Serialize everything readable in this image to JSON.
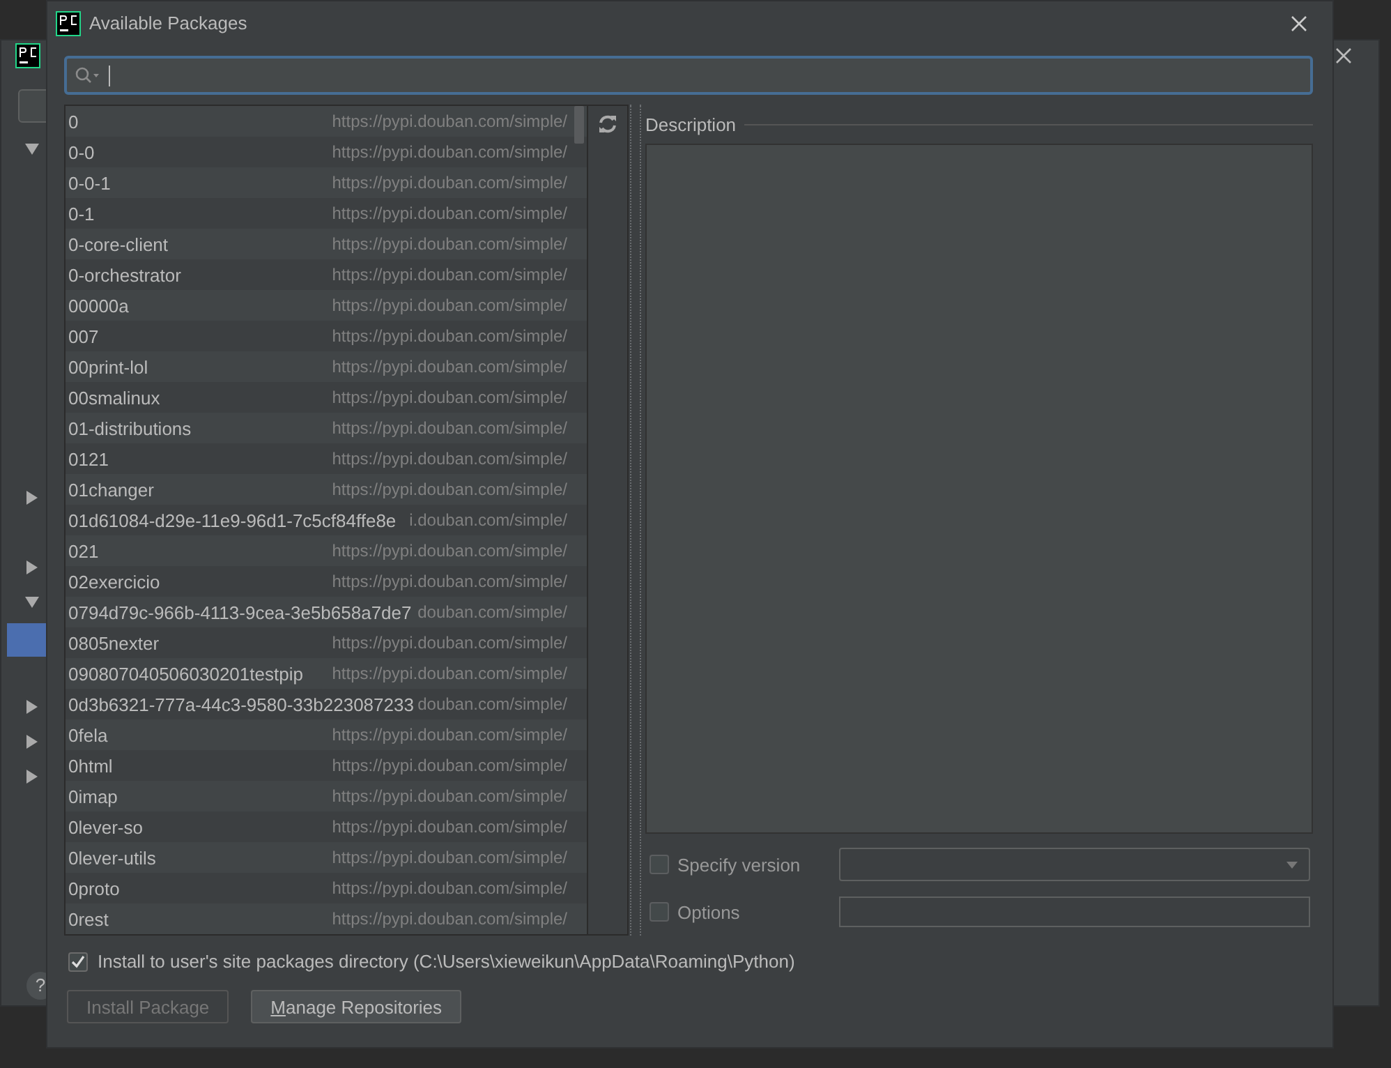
{
  "background_window": {
    "help": "?"
  },
  "window": {
    "title": "Available Packages"
  },
  "packages": [
    {
      "name": "0",
      "repository": "https://pypi.douban.com/simple/"
    },
    {
      "name": "0-0",
      "repository": "https://pypi.douban.com/simple/"
    },
    {
      "name": "0-0-1",
      "repository": "https://pypi.douban.com/simple/"
    },
    {
      "name": "0-1",
      "repository": "https://pypi.douban.com/simple/"
    },
    {
      "name": "0-core-client",
      "repository": "https://pypi.douban.com/simple/"
    },
    {
      "name": "0-orchestrator",
      "repository": "https://pypi.douban.com/simple/"
    },
    {
      "name": "00000a",
      "repository": "https://pypi.douban.com/simple/"
    },
    {
      "name": "007",
      "repository": "https://pypi.douban.com/simple/"
    },
    {
      "name": "00print-lol",
      "repository": "https://pypi.douban.com/simple/"
    },
    {
      "name": "00smalinux",
      "repository": "https://pypi.douban.com/simple/"
    },
    {
      "name": "01-distributions",
      "repository": "https://pypi.douban.com/simple/"
    },
    {
      "name": "0121",
      "repository": "https://pypi.douban.com/simple/"
    },
    {
      "name": "01changer",
      "repository": "https://pypi.douban.com/simple/"
    },
    {
      "name": "01d61084-d29e-11e9-96d1-7c5cf84ffe8e",
      "repository": "i.douban.com/simple/"
    },
    {
      "name": "021",
      "repository": "https://pypi.douban.com/simple/"
    },
    {
      "name": "02exercicio",
      "repository": "https://pypi.douban.com/simple/"
    },
    {
      "name": "0794d79c-966b-4113-9cea-3e5b658a7de7",
      "repository": "douban.com/simple/"
    },
    {
      "name": "0805nexter",
      "repository": "https://pypi.douban.com/simple/"
    },
    {
      "name": "090807040506030201testpip",
      "repository": "https://pypi.douban.com/simple/"
    },
    {
      "name": "0d3b6321-777a-44c3-9580-33b223087233",
      "repository": "douban.com/simple/"
    },
    {
      "name": "0fela",
      "repository": "https://pypi.douban.com/simple/"
    },
    {
      "name": "0html",
      "repository": "https://pypi.douban.com/simple/"
    },
    {
      "name": "0imap",
      "repository": "https://pypi.douban.com/simple/"
    },
    {
      "name": "0lever-so",
      "repository": "https://pypi.douban.com/simple/"
    },
    {
      "name": "0lever-utils",
      "repository": "https://pypi.douban.com/simple/"
    },
    {
      "name": "0proto",
      "repository": "https://pypi.douban.com/simple/"
    },
    {
      "name": "0rest",
      "repository": "https://pypi.douban.com/simple/"
    }
  ],
  "description": {
    "label": "Description"
  },
  "specify_version": {
    "label": "Specify version",
    "checked": false
  },
  "options": {
    "label": "Options",
    "checked": false
  },
  "install_to_user": {
    "label": "Install to user's site packages directory (C:\\Users\\xieweikun\\AppData\\Roaming\\Python)",
    "checked": true
  },
  "buttons": [
    {
      "label": "Install Package",
      "disabled": true
    },
    {
      "label": "Manage Repositories",
      "disabled": false
    }
  ]
}
